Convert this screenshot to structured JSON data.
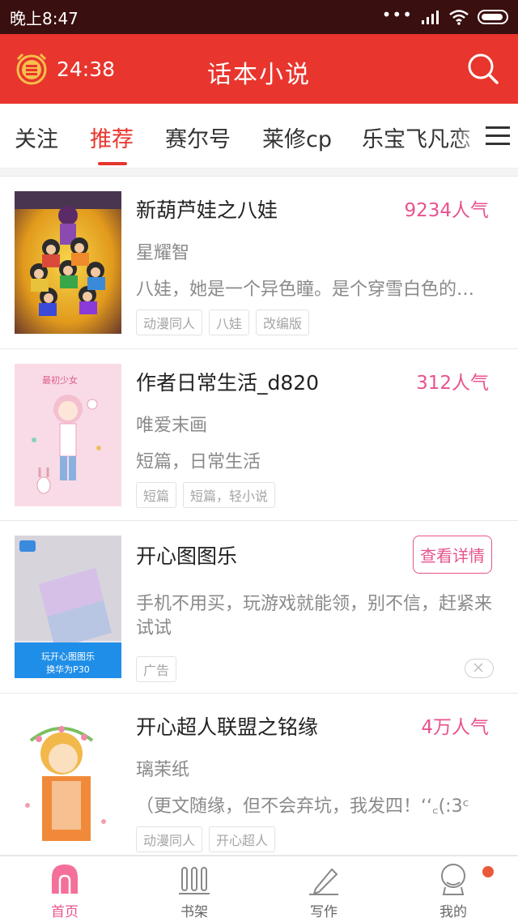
{
  "status_bar": {
    "time": "晚上8:47",
    "signal_dots": "•••"
  },
  "header": {
    "timer": "24:38",
    "title": "话本小说",
    "accent_color": "#e8352d"
  },
  "tabs": [
    {
      "label": "关注",
      "active": false
    },
    {
      "label": "推荐",
      "active": true
    },
    {
      "label": "赛尔号",
      "active": false
    },
    {
      "label": "莱修cp",
      "active": false
    },
    {
      "label": "乐宝飞凡恋",
      "active": false
    }
  ],
  "items": [
    {
      "title": "新葫芦娃之八娃",
      "popularity": "9234人气",
      "author": "星耀智",
      "desc": "八娃，她是一个异色瞳。是个穿雪白色的…",
      "tags": [
        "动漫同人",
        "八娃",
        "改编版"
      ],
      "cover_icon": "calabash-brothers-cover"
    },
    {
      "title": "作者日常生活_d820",
      "popularity": "312人气",
      "author": "唯爱末画",
      "desc": "短篇，日常生活",
      "tags": [
        "短篇",
        "短篇，轻小说"
      ],
      "cover_icon": "anime-girl-cover",
      "cover_text": "最初少女"
    },
    {
      "title": "开心图图乐",
      "action": "查看详情",
      "desc": "手机不用买，玩游戏就能领，别不信，赶紧来试试",
      "tags": [
        "广告"
      ],
      "cover_caption_1": "玩开心图图乐",
      "cover_caption_2": "换华为P30",
      "cover_icon": "phone-ad-cover"
    },
    {
      "title": "开心超人联盟之铭缘",
      "popularity": "4万人气",
      "author": "璃茉纸",
      "desc": "（更文随缘，但不会弃坑，我发四！ʻʻ꜀(:3ᶜ",
      "tags": [
        "动漫同人",
        "开心超人"
      ],
      "cover_icon": "anime-boy-cover"
    }
  ],
  "bottom_nav": [
    {
      "label": "首页",
      "icon": "home-icon",
      "active": true
    },
    {
      "label": "书架",
      "icon": "bookshelf-icon",
      "active": false
    },
    {
      "label": "写作",
      "icon": "pencil-icon",
      "active": false
    },
    {
      "label": "我的",
      "icon": "profile-icon",
      "active": false
    }
  ]
}
